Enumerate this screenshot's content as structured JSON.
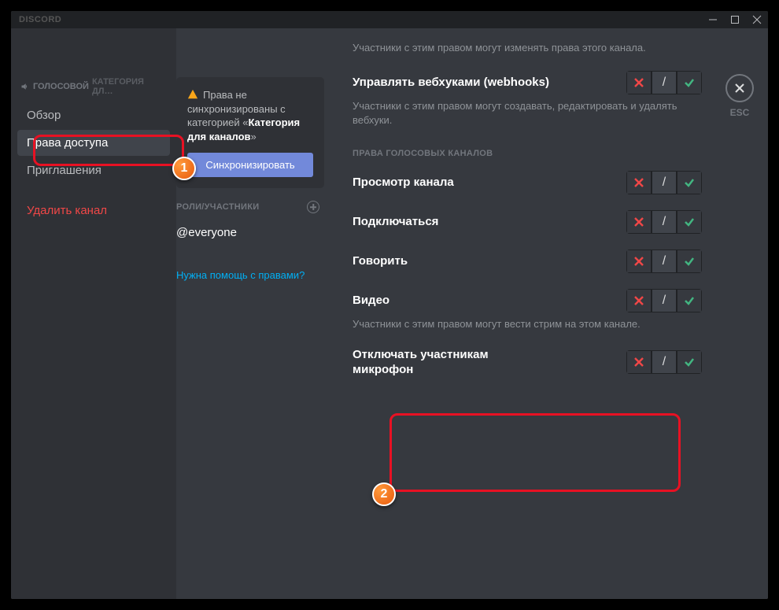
{
  "titlebar": {
    "logo": "DISCORD"
  },
  "close": {
    "esc": "ESC"
  },
  "sidebar": {
    "channel_icon_label": "volume-icon",
    "channel_name": "ГОЛОСОВОЙ",
    "category_suffix": "КАТЕГОРИЯ ДЛ…",
    "items": {
      "overview": "Обзор",
      "permissions": "Права доступа",
      "invites": "Приглашения",
      "delete": "Удалить канал"
    }
  },
  "sync": {
    "text_prefix": "Права не синхронизированы с категорией «",
    "category": "Категория для каналов",
    "text_suffix": "»",
    "button": "Синхронизировать"
  },
  "roles": {
    "head": "РОЛИ/УЧАСТНИКИ",
    "items": {
      "everyone": "@everyone"
    },
    "help": "Нужна помощь с правами?"
  },
  "permissions": {
    "top_desc": "Участники с этим правом могут изменять права этого канала.",
    "webhooks": {
      "title": "Управлять вебхуками (webhooks)",
      "desc": "Участники с этим правом могут создавать, редактировать и удалять вебхуки."
    },
    "voice_head": "ПРАВА ГОЛОСОВЫХ КАНАЛОВ",
    "view": {
      "title": "Просмотр канала"
    },
    "connect": {
      "title": "Подключаться"
    },
    "speak": {
      "title": "Говорить"
    },
    "video": {
      "title": "Видео",
      "desc": "Участники с этим правом могут вести стрим на этом канале."
    },
    "mute": {
      "title": "Отключать участникам микрофон"
    }
  },
  "tri": {
    "slash": "/"
  },
  "badges": {
    "one": "1",
    "two": "2"
  }
}
